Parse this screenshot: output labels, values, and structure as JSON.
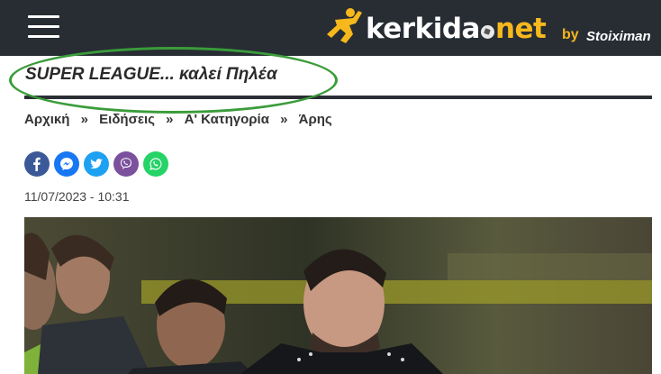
{
  "header": {
    "brand_main": "kerkida",
    "brand_tld": "net",
    "brand_by": "by",
    "sponsor": "Stoiximan",
    "menu_icon": "hamburger-menu-icon",
    "background_color": "#272d33",
    "accent_color": "#f6b81c"
  },
  "article": {
    "title": "SUPER LEAGUE... καλεί Πηλέα",
    "date": "11/07/2023 - 10:31",
    "breadcrumb": [
      "Αρχική",
      "Ειδήσεις",
      "Α' Κατηγορία",
      "Άρης"
    ],
    "breadcrumb_separator": "»"
  },
  "share": [
    {
      "icon": "facebook-icon",
      "color": "#3b5998"
    },
    {
      "icon": "messenger-icon",
      "color": "#1877f2"
    },
    {
      "icon": "twitter-icon",
      "color": "#1da1f2"
    },
    {
      "icon": "viber-icon",
      "color": "#7b519d"
    },
    {
      "icon": "whatsapp-icon",
      "color": "#25d366"
    }
  ],
  "annotation_color": "#3a9c3a"
}
